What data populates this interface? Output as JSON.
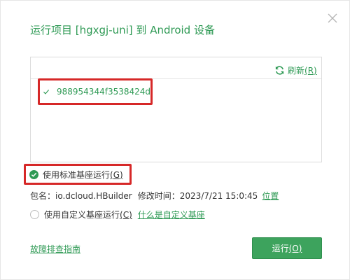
{
  "dialog": {
    "title": "运行项目 [hgxgj-uni] 到 Android 设备",
    "close_icon": "close-icon"
  },
  "devices": {
    "refresh_label": "刷新",
    "refresh_hotkey": "(R)",
    "refresh_icon": "refresh-icon",
    "items": [
      {
        "id": "988954344f3538424d",
        "selected": true
      }
    ]
  },
  "base_options": {
    "standard": {
      "label": "使用标准基座运行",
      "hotkey": "(G)",
      "selected": true
    },
    "package": {
      "name_label": "包名：",
      "name_value": "io.dcloud.HBuilder",
      "modified_label": "修改时间：",
      "modified_value": "2023/7/21 15:0:45",
      "location_link": "位置"
    },
    "custom": {
      "label": "使用自定义基座运行",
      "hotkey": "(C)",
      "selected": false,
      "help_link": "什么是自定义基座"
    }
  },
  "footer": {
    "troubleshoot_link": "故障排查指南",
    "run_label": "运行",
    "run_hotkey": "(O)"
  },
  "colors": {
    "accent": "#2f9a55",
    "button_bg": "#3da35d",
    "highlight_box": "#d62828"
  }
}
